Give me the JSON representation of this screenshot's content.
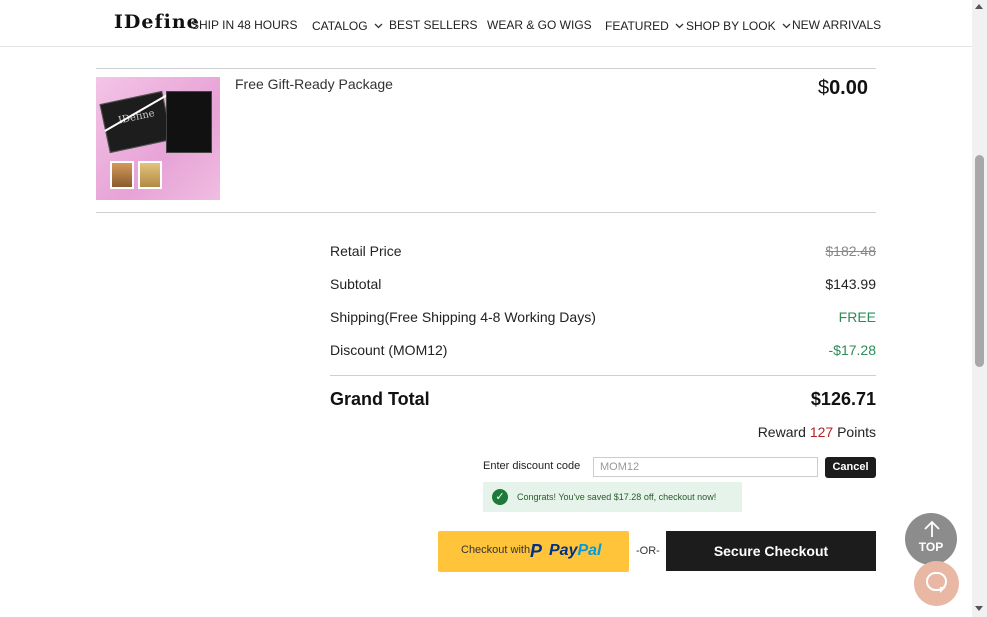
{
  "header": {
    "logo": "IDefine",
    "nav": [
      {
        "label": "SHIP IN 48 HOURS",
        "has_dropdown": false
      },
      {
        "label": "CATALOG",
        "has_dropdown": true
      },
      {
        "label": "BEST SELLERS",
        "has_dropdown": false
      },
      {
        "label": "WEAR & GO WIGS",
        "has_dropdown": false
      },
      {
        "label": "FEATURED",
        "has_dropdown": true
      },
      {
        "label": "SHOP BY LOOK",
        "has_dropdown": true
      },
      {
        "label": "NEW ARRIVALS",
        "has_dropdown": false
      }
    ],
    "chevron_icon": "chevron-down-icon"
  },
  "cart_item": {
    "name": "Free Gift-Ready Package",
    "currency_symbol": "$",
    "price": "0.00",
    "image_logo_text": "IDefine"
  },
  "summary": {
    "retail_price_label": "Retail Price",
    "retail_price_value": "$182.48",
    "subtotal_label": "Subtotal",
    "subtotal_value": "$143.99",
    "shipping_label": "Shipping(Free Shipping 4-8 Working Days)",
    "shipping_value": "FREE",
    "discount_label": "Discount (MOM12)",
    "discount_value": "-$17.28",
    "grand_total_label": "Grand Total",
    "grand_total_value": "$126.71",
    "reward_prefix": "Reward",
    "reward_points": "127",
    "reward_suffix": "Points"
  },
  "discount_code": {
    "label": "Enter discount code",
    "value": "MOM12",
    "cancel_label": "Cancel",
    "success_message": "Congrats! You've saved $17.28 off, checkout now!"
  },
  "checkout": {
    "paypal_prefix": "Checkout with",
    "paypal_word_a": "Pay",
    "paypal_word_b": "Pal",
    "or_label": "-OR-",
    "secure_checkout_label": "Secure Checkout"
  },
  "floating": {
    "top_label": "TOP",
    "top_icon": "arrow-up-icon",
    "chat_icon": "chat-bubble-icon"
  },
  "colors": {
    "accent_dark": "#1c1c1c",
    "paypal_yellow": "#ffc439",
    "success_green": "#2e8b57",
    "reward_red": "#b22222"
  }
}
